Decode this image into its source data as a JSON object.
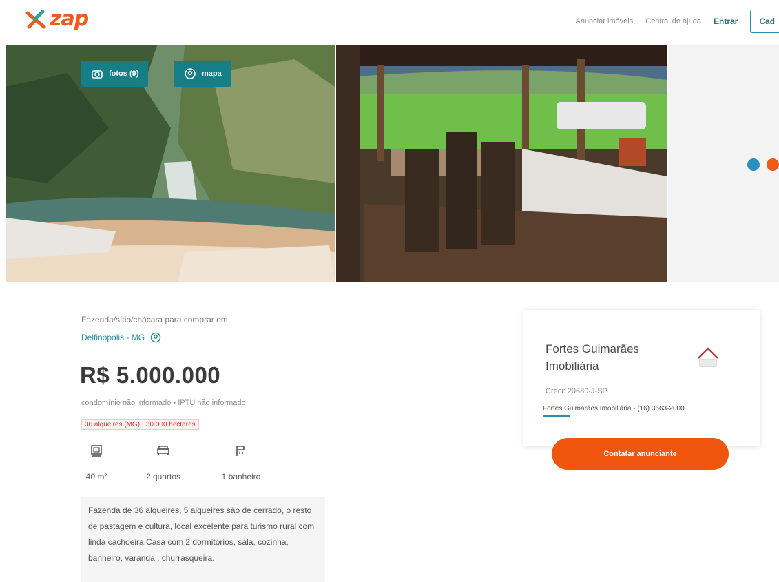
{
  "header": {
    "logo_text": "zap",
    "nav": {
      "anunciar": "Anunciar imóveis",
      "central": "Central de ajuda",
      "entrar": "Entrar",
      "cadastrar": "Cad"
    }
  },
  "gallery": {
    "fotos_label": "fotos (9)",
    "mapa_label": "mapa"
  },
  "listing": {
    "subtitle": "Fazenda/sítio/chácara para comprar em",
    "location": "Delfinópolis - MG",
    "price": "R$ 5.000.000",
    "fees": "condomínio não informado  •  IPTU não informado",
    "tags": "36 alqueires (MG) · 30.000 hectares",
    "features": [
      {
        "icon": "area-icon",
        "label": "40 m²"
      },
      {
        "icon": "bed-icon",
        "label": "2 quartos"
      },
      {
        "icon": "bath-icon",
        "label": "1 banheiro"
      }
    ],
    "description": "Fazenda de 36 alqueires, 5 alqueires são de cerrado, o resto de pastagem e cultura, local excelente para turismo rural com linda cachoeira.Casa com 2 dormitórios, sala, cozinha, banheiro, varanda , churrasqueira."
  },
  "advertiser": {
    "name": "Fortes Guimarães Imobiliária",
    "creci": "Creci: 20680-J-SP",
    "contact": "Fortes Guimarães Imobiliária - (16) 3663-2000",
    "cta": "Contatar anunciante"
  },
  "colors": {
    "brand_orange": "#f05a1a",
    "teal": "#167e87",
    "cta_orange": "#f0560e"
  }
}
